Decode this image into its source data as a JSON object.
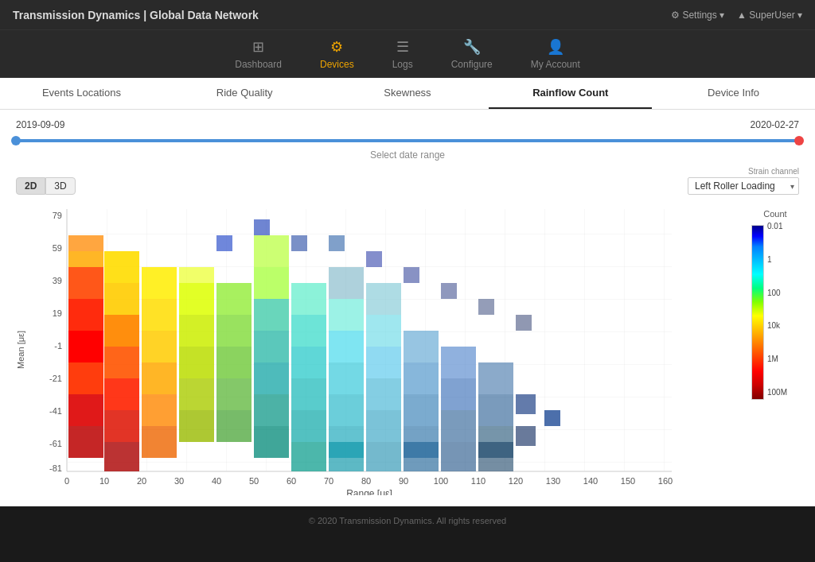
{
  "header": {
    "title": "Transmission Dynamics | Global Data Network",
    "settings_label": "⚙ Settings ▾",
    "user_label": "▲ SuperUser ▾"
  },
  "nav": {
    "items": [
      {
        "id": "dashboard",
        "label": "Dashboard",
        "icon": "⊞",
        "active": false
      },
      {
        "id": "devices",
        "label": "Devices",
        "icon": "⚙",
        "active": true
      },
      {
        "id": "logs",
        "label": "Logs",
        "icon": "≡",
        "active": false
      },
      {
        "id": "configure",
        "label": "Configure",
        "icon": "🔧",
        "active": false
      },
      {
        "id": "my-account",
        "label": "My Account",
        "icon": "👤",
        "active": false
      }
    ]
  },
  "tabs": [
    {
      "id": "events-locations",
      "label": "Events Locations",
      "active": false
    },
    {
      "id": "ride-quality",
      "label": "Ride Quality",
      "active": false
    },
    {
      "id": "skewness",
      "label": "Skewness",
      "active": false
    },
    {
      "id": "rainflow-count",
      "label": "Rainflow Count",
      "active": true
    },
    {
      "id": "device-info",
      "label": "Device Info",
      "active": false
    }
  ],
  "date_range": {
    "start": "2019-09-09",
    "end": "2020-02-27",
    "hint": "Select date range"
  },
  "view_buttons": [
    {
      "id": "2d",
      "label": "2D",
      "active": true
    },
    {
      "id": "3d",
      "label": "3D",
      "active": false
    }
  ],
  "strain_channel": {
    "label": "Strain channel",
    "value": "Left Roller Loading"
  },
  "chart": {
    "y_axis_label": "Mean [με]",
    "x_axis_label": "Range [με]",
    "y_ticks": [
      "79",
      "59",
      "39",
      "19",
      "-1",
      "-21",
      "-41",
      "-61",
      "-81"
    ],
    "x_ticks": [
      "0",
      "10",
      "20",
      "30",
      "40",
      "50",
      "60",
      "70",
      "80",
      "90",
      "100",
      "110",
      "120",
      "130",
      "140",
      "150",
      "160"
    ]
  },
  "legend": {
    "title": "Count",
    "values": [
      "0.01",
      "1",
      "100",
      "10k",
      "1M",
      "100M"
    ]
  },
  "footer": {
    "text": "© 2020 Transmission Dynamics. All rights reserved"
  }
}
